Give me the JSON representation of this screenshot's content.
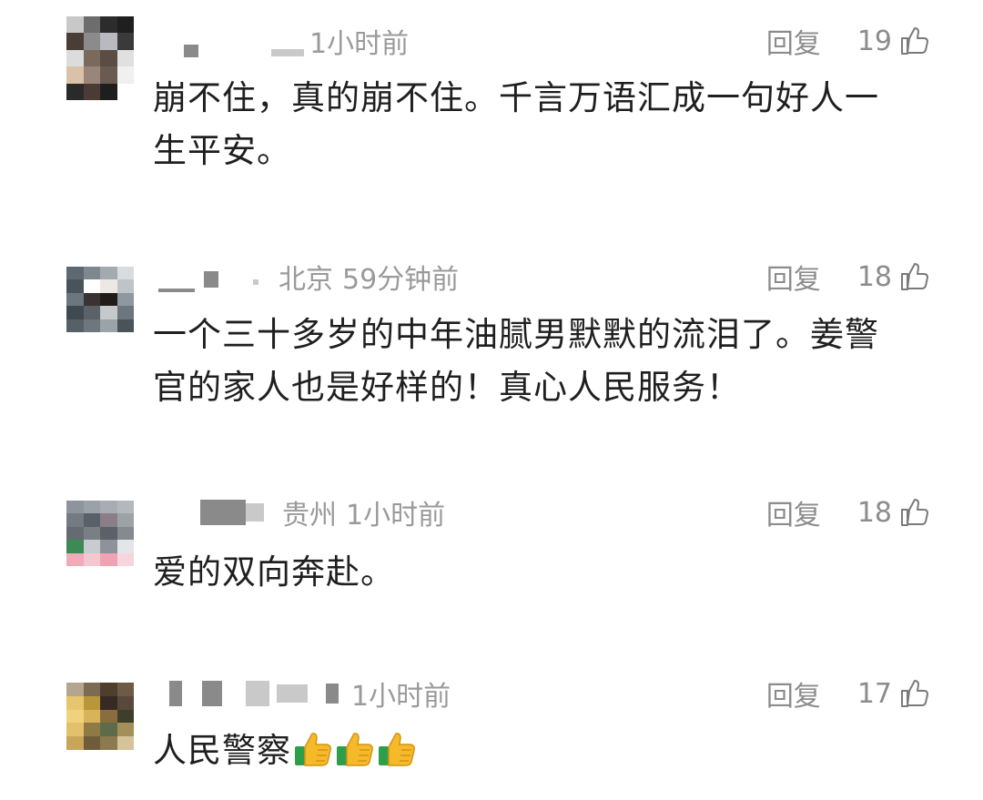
{
  "comments": [
    {
      "location": "",
      "time": "1小时前",
      "reply_label": "回复",
      "likes": "19",
      "text": "崩不住，真的崩不住。千言万语汇成一句好人一生平安。",
      "avatar_icon": "pixelated-avatar-icon"
    },
    {
      "location": "北京",
      "time": "59分钟前",
      "reply_label": "回复",
      "likes": "18",
      "text": "一个三十多岁的中年油腻男默默的流泪了。姜警官的家人也是好样的！真心人民服务！",
      "avatar_icon": "pixelated-avatar-icon"
    },
    {
      "location": "贵州",
      "time": "1小时前",
      "reply_label": "回复",
      "likes": "18",
      "text": "爱的双向奔赴。",
      "avatar_icon": "pixelated-avatar-icon"
    },
    {
      "location": "",
      "time": "1小时前",
      "reply_label": "回复",
      "likes": "17",
      "text": "人民警察",
      "emoji": "thumbs-up-emoji x3",
      "avatar_icon": "pixelated-avatar-icon"
    }
  ],
  "colors": {
    "meta_gray": "#9a9a9a",
    "text": "#1f1f1f",
    "thumb_yellow": "#f5b92a",
    "thumb_green": "#2e9e4a"
  },
  "icons": {
    "like": "thumbs-up-outline-icon",
    "emoji": "thumbs-up-emoji-icon"
  }
}
